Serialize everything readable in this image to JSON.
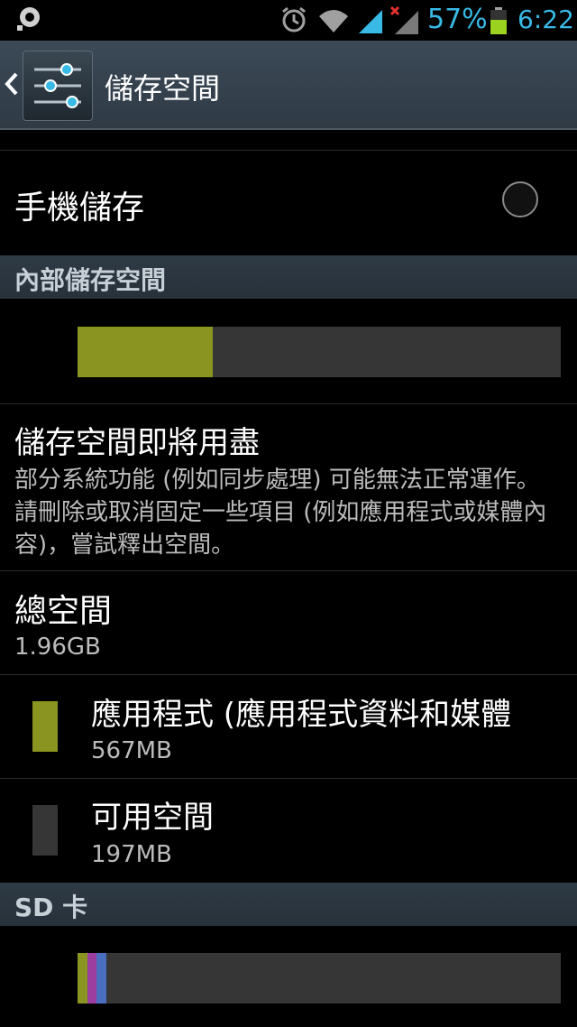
{
  "status_bar": {
    "battery_percent": "57%",
    "time": "6:22",
    "accent_color": "#39b9e6",
    "icons": [
      "notification-icon",
      "alarm-icon",
      "wifi-icon",
      "signal-icon",
      "no-signal-icon",
      "battery-icon"
    ]
  },
  "action_bar": {
    "title": "儲存空間",
    "icon": "settings-sliders-icon"
  },
  "phone_storage": {
    "label": "手機儲存",
    "selected": false
  },
  "internal_section": {
    "header": "內部儲存空間",
    "usage_fraction": 0.28,
    "usage_color": "#8a9420"
  },
  "low_storage": {
    "title": "儲存空間即將用盡",
    "description": "部分系統功能 (例如同步處理) 可能無法正常運作。請刪除或取消固定一些項目 (例如應用程式或媒體內容)，嘗試釋出空間。"
  },
  "total_space": {
    "title": "總空間",
    "value": "1.96GB"
  },
  "apps_entry": {
    "title": "應用程式 (應用程式資料和媒體",
    "value": "567MB",
    "color": "#8a9420"
  },
  "available_entry": {
    "title": "可用空間",
    "value": "197MB",
    "color": "#363636"
  },
  "sd_section": {
    "header": "SD 卡",
    "segments": [
      {
        "fraction": 0.02,
        "color": "#8a9420"
      },
      {
        "fraction": 0.02,
        "color": "#9b3ea0"
      },
      {
        "fraction": 0.02,
        "color": "#4a6fbf"
      }
    ]
  }
}
